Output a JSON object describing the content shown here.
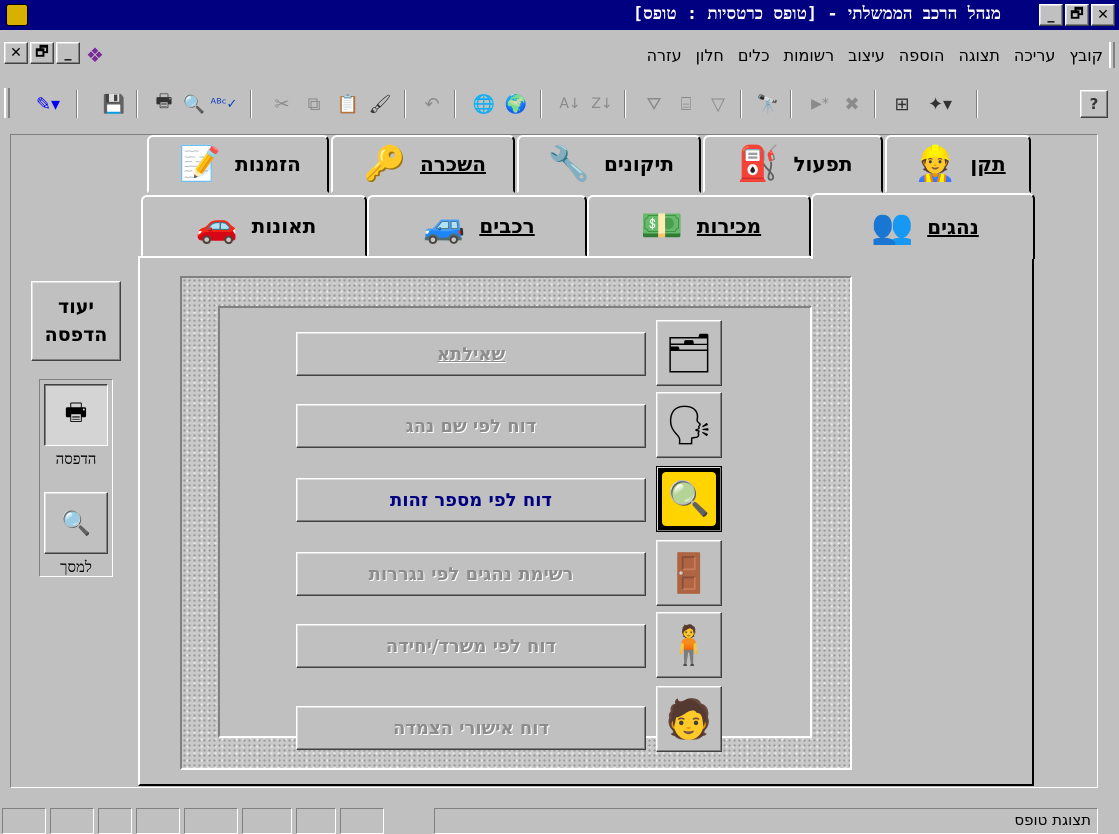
{
  "window": {
    "title": "מנהל הרכב הממשלתי - [טופס כרטסיות : טופס]",
    "controls": {
      "minimize": "_",
      "restore": "🗗",
      "close": "✕"
    }
  },
  "menu": {
    "items": [
      "קובץ",
      "עריכה",
      "תצוגה",
      "הוספה",
      "עיצוב",
      "רשומות",
      "כלים",
      "חלון",
      "עזרה"
    ]
  },
  "toolbar": {
    "icons": [
      "design-view",
      "save",
      "print",
      "print-preview",
      "spelling",
      "cut",
      "copy",
      "paste",
      "format-painter",
      "undo",
      "hyperlink",
      "web-toolbar",
      "sort-ascending",
      "sort-descending",
      "filter-by-selection",
      "filter-by-form",
      "apply-filter",
      "find",
      "new-record",
      "delete-record",
      "database-window",
      "new-object",
      "help"
    ]
  },
  "tabs": {
    "row_back": [
      {
        "label": "תקן",
        "icon": "worker-icon"
      },
      {
        "label": "תפעול",
        "icon": "fuel-pump-icon"
      },
      {
        "label": "תיקונים",
        "icon": "wrench-icon"
      },
      {
        "label": "השכרה",
        "icon": "keys-icon"
      },
      {
        "label": "הזמנות",
        "icon": "order-form-icon"
      }
    ],
    "row_front": [
      {
        "label": "נהגים",
        "icon": "drivers-icon",
        "selected": true
      },
      {
        "label": "מכירות",
        "icon": "money-icon"
      },
      {
        "label": "רכבים",
        "icon": "cars-icon"
      },
      {
        "label": "תאונות",
        "icon": "crash-icon"
      }
    ]
  },
  "reports": [
    {
      "label": "שאילתא",
      "enabled": false,
      "icon": "query-icon"
    },
    {
      "label": "דוח לפי שם נהג",
      "enabled": false,
      "icon": "people-talking-icon"
    },
    {
      "label": "דוח לפי מספר זהות",
      "enabled": true,
      "icon": "magnifier-face-icon"
    },
    {
      "label": "רשימת נהגים לפי נגררות",
      "enabled": false,
      "icon": "driver-list-icon"
    },
    {
      "label": "דוח לפי משרד/יחידה",
      "enabled": false,
      "icon": "office-unit-icon"
    },
    {
      "label": "דוח אישורי הצמדה",
      "enabled": false,
      "icon": "assignment-approval-icon"
    }
  ],
  "print_wizard": {
    "line1": "יעוד",
    "line2": "הדפסה"
  },
  "print_options": {
    "print_label": "הדפסה",
    "screen_label": "למסך",
    "selected": "print"
  },
  "status": {
    "text": "תצוגת טופס"
  }
}
